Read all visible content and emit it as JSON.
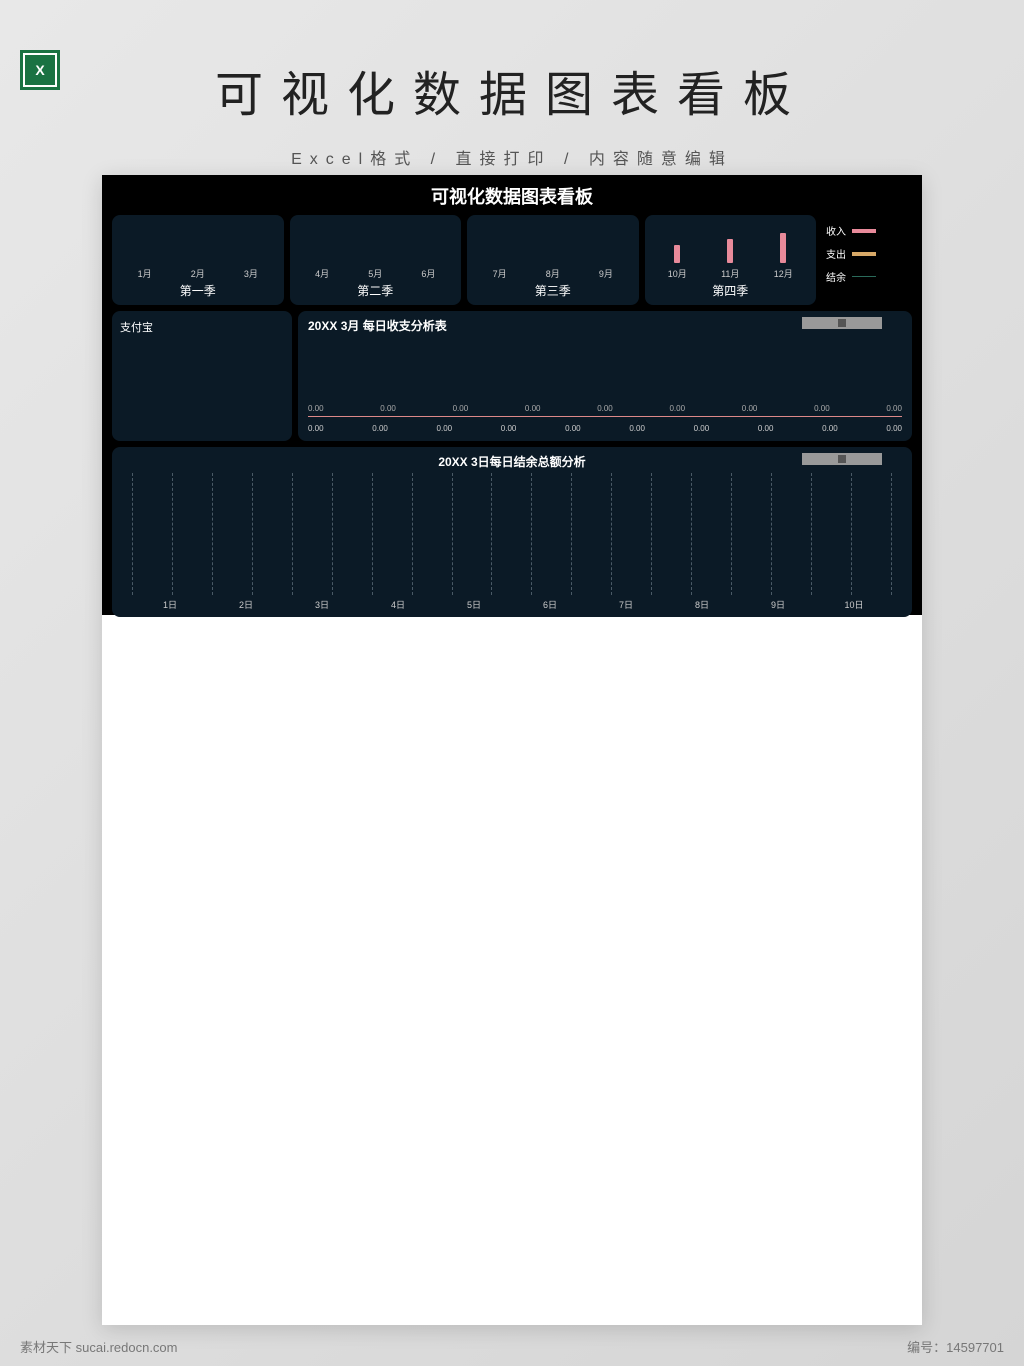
{
  "header": {
    "excel_label": "X",
    "title": "可视化数据图表看板",
    "subtitle": "Excel格式 / 直接打印 / 内容随意编辑"
  },
  "dashboard": {
    "title": "可视化数据图表看板",
    "quarters": [
      {
        "label": "第一季",
        "months": [
          "1月",
          "2月",
          "3月"
        ],
        "bars": [
          0,
          0,
          0
        ]
      },
      {
        "label": "第二季",
        "months": [
          "4月",
          "5月",
          "6月"
        ],
        "bars": [
          0,
          0,
          0
        ]
      },
      {
        "label": "第三季",
        "months": [
          "7月",
          "8月",
          "9月"
        ],
        "bars": [
          0,
          0,
          0
        ]
      },
      {
        "label": "第四季",
        "months": [
          "10月",
          "11月",
          "12月"
        ],
        "bars": [
          18,
          24,
          30
        ]
      }
    ],
    "legend": [
      {
        "label": "收入",
        "color": "#e88a9a"
      },
      {
        "label": "支出",
        "color": "#d8a968"
      },
      {
        "label": "结余",
        "color": "#2a6a5a"
      }
    ],
    "left_card": {
      "title": "支付宝"
    },
    "daily": {
      "title": "20XX   3月   每日收支分析表",
      "values": [
        "0.00",
        "0.00",
        "0.00",
        "0.00",
        "0.00",
        "0.00",
        "0.00",
        "0.00",
        "0.00"
      ],
      "xlabels": [
        "0.00",
        "0.00",
        "0.00",
        "0.00",
        "0.00",
        "0.00",
        "0.00",
        "0.00",
        "0.00",
        "0.00"
      ]
    },
    "bottom": {
      "title": "20XX 3日每日结余总额分析",
      "days": [
        "1日",
        "2日",
        "3日",
        "4日",
        "5日",
        "6日",
        "7日",
        "8日",
        "9日",
        "10日"
      ],
      "gridlines": 20
    }
  },
  "footer": {
    "left": "素材天下 sucai.redocn.com",
    "right_label": "编号：",
    "right_value": "14597701"
  },
  "chart_data": [
    {
      "type": "bar",
      "title": "第一季",
      "categories": [
        "1月",
        "2月",
        "3月"
      ],
      "values": [
        0,
        0,
        0
      ]
    },
    {
      "type": "bar",
      "title": "第二季",
      "categories": [
        "4月",
        "5月",
        "6月"
      ],
      "values": [
        0,
        0,
        0
      ]
    },
    {
      "type": "bar",
      "title": "第三季",
      "categories": [
        "7月",
        "8月",
        "9月"
      ],
      "values": [
        0,
        0,
        0
      ]
    },
    {
      "type": "bar",
      "title": "第四季",
      "categories": [
        "10月",
        "11月",
        "12月"
      ],
      "values": [
        18,
        24,
        30
      ]
    },
    {
      "type": "bar",
      "title": "20XX 3月 每日收支分析表",
      "categories": [
        "0.00",
        "0.00",
        "0.00",
        "0.00",
        "0.00",
        "0.00",
        "0.00",
        "0.00",
        "0.00",
        "0.00"
      ],
      "series": [
        {
          "name": "收入",
          "values": [
            0,
            0,
            0,
            0,
            0,
            0,
            0,
            0,
            0,
            0
          ]
        },
        {
          "name": "支出",
          "values": [
            0,
            0,
            0,
            0,
            0,
            0,
            0,
            0,
            0,
            0
          ]
        }
      ]
    },
    {
      "type": "line",
      "title": "20XX 3日每日结余总额分析",
      "categories": [
        "1日",
        "2日",
        "3日",
        "4日",
        "5日",
        "6日",
        "7日",
        "8日",
        "9日",
        "10日"
      ],
      "values": [
        0,
        0,
        0,
        0,
        0,
        0,
        0,
        0,
        0,
        0
      ]
    }
  ]
}
